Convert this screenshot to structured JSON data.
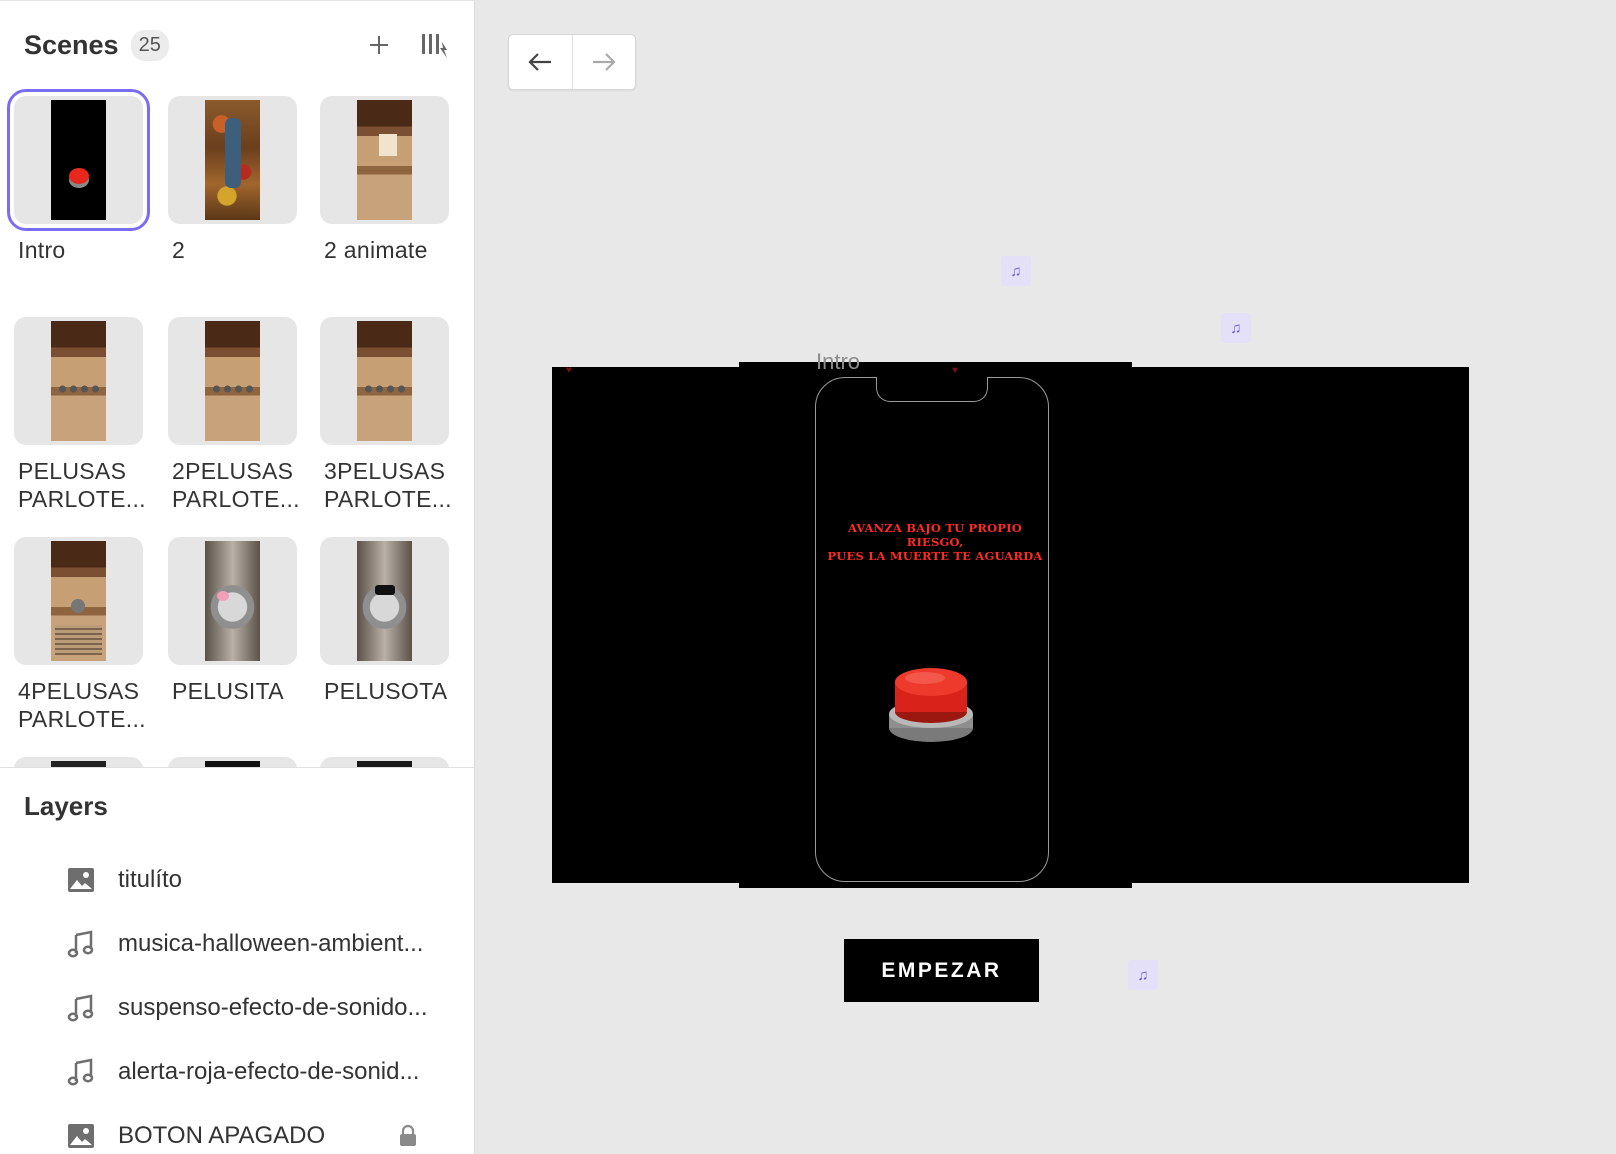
{
  "scenes": {
    "title": "Scenes",
    "count": "25",
    "add_icon": "plus-icon",
    "sort_icon": "sort-icon",
    "items": [
      {
        "label": "Intro",
        "thumb": "black-red-button"
      },
      {
        "label": "2",
        "thumb": "person-on-fruits"
      },
      {
        "label": "2 animate",
        "thumb": "wooden-room"
      },
      {
        "label": "PELUSAS PARLOTE...",
        "thumb": "wooden-room-pelusas"
      },
      {
        "label": "2PELUSAS PARLOTE...",
        "thumb": "wooden-room-pelusas"
      },
      {
        "label": "3PELUSAS PARLOTE...",
        "thumb": "wooden-room-pelusas"
      },
      {
        "label": "4PELUSAS PARLOTE...",
        "thumb": "wooden-room-pelusa-text"
      },
      {
        "label": "PELUSITA",
        "thumb": "fluffy-bow"
      },
      {
        "label": "PELUSOTA",
        "thumb": "fluffy-hat"
      }
    ]
  },
  "layers": {
    "title": "Layers",
    "items": [
      {
        "label": "titulíto",
        "icon": "image-icon"
      },
      {
        "label": "musica-halloween-ambient...",
        "icon": "music-note-icon"
      },
      {
        "label": "suspenso-efecto-de-sonido...",
        "icon": "music-note-icon"
      },
      {
        "label": "alerta-roja-efecto-de-sonid...",
        "icon": "music-note-icon"
      },
      {
        "label": "BOTON APAGADO",
        "icon": "image-icon",
        "locked": true
      }
    ]
  },
  "toolbar": {
    "back_icon": "arrow-left-icon",
    "forward_icon": "arrow-right-icon"
  },
  "canvas": {
    "scene_label": "Intro",
    "warning_line1": "AVANZA BAJO TU PROPIO RIESGO,",
    "warning_line2": "PUES LA MUERTE TE AGUARDA",
    "start_button": "EMPEZAR",
    "audio_icon": "♫"
  },
  "colors": {
    "accent": "#7b6cf6",
    "warning_red": "#ff2a22",
    "button_red": "#e8281c"
  }
}
